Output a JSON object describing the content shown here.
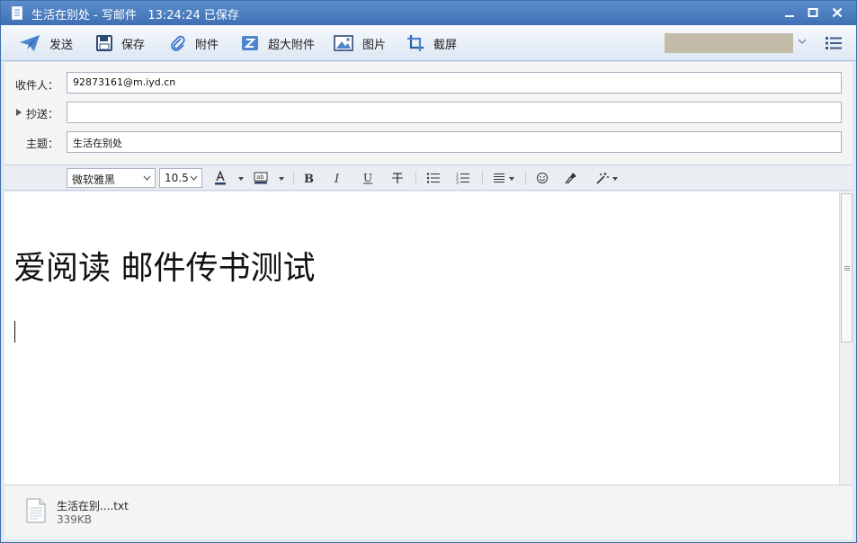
{
  "window": {
    "title": "生活在别处 - 写邮件   13:24:24 已保存"
  },
  "toolbar": {
    "send": "发送",
    "save": "保存",
    "attach": "附件",
    "large_attach": "超大附件",
    "picture": "图片",
    "screenshot": "截屏"
  },
  "headers": {
    "to_label": "收件人：",
    "to_value": "92873161@m.iyd.cn",
    "cc_label": "抄送：",
    "cc_value": "",
    "subject_label": "主题：",
    "subject_value": "生活在别处"
  },
  "format": {
    "font": "微软雅黑",
    "size": "10.5"
  },
  "editor": {
    "body": "爱阅读 邮件传书测试"
  },
  "attachments": [
    {
      "name": "生活在别....txt",
      "size": "339KB"
    }
  ],
  "colors": {
    "titlebar": "#4a7ec2",
    "accent": "#2d6cc0"
  }
}
